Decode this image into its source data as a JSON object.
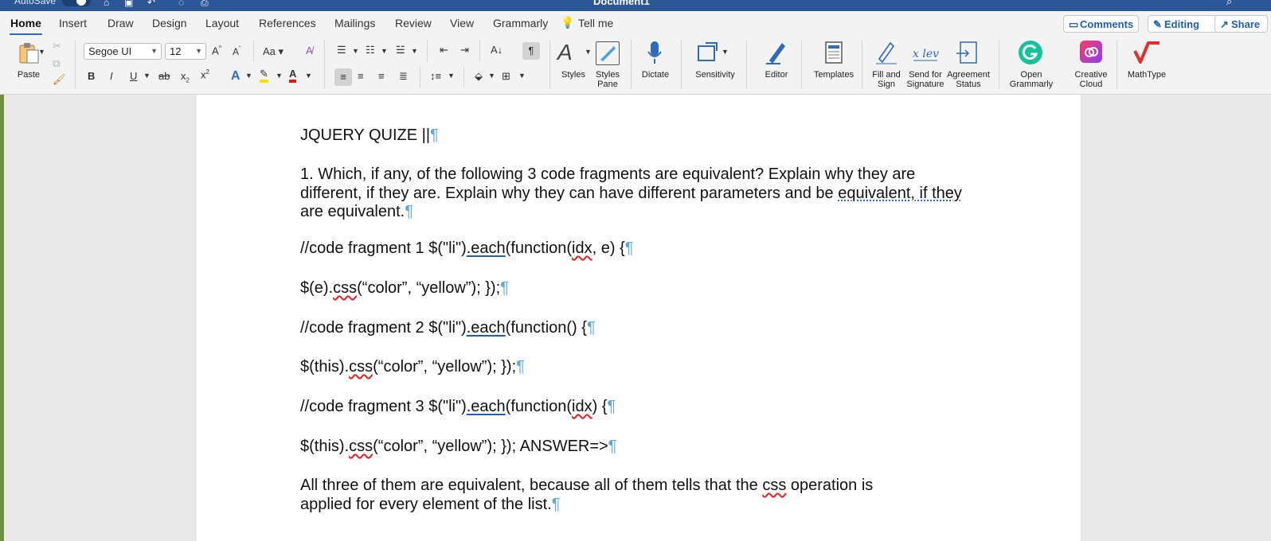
{
  "titlebar": {
    "autosave": "AutoSave",
    "document_title": "Document1"
  },
  "tabs": [
    "Home",
    "Insert",
    "Draw",
    "Design",
    "Layout",
    "References",
    "Mailings",
    "Review",
    "View",
    "Grammarly"
  ],
  "tell_me": "Tell me",
  "comments_label": "Comments",
  "editing_label": "Editing",
  "share_label": "Share",
  "ribbon": {
    "paste_label": "Paste",
    "font_name": "Segoe UI",
    "font_size": "12",
    "styles": "Styles",
    "styles_pane_1": "Styles",
    "styles_pane_2": "Pane",
    "dictate": "Dictate",
    "sensitivity": "Sensitivity",
    "editor": "Editor",
    "templates": "Templates",
    "fill_sign_1": "Fill and",
    "fill_sign_2": "Sign",
    "send_sig_1": "Send for",
    "send_sig_2": "Signature",
    "agreement_1": "Agreement",
    "agreement_2": "Status",
    "grammarly_1": "Open",
    "grammarly_2": "Grammarly",
    "cc_1": "Creative",
    "cc_2": "Cloud",
    "mathtype": "MathType"
  },
  "doc": {
    "title": "JQUERY QUIZE ||",
    "q1_line1": "1. Which, if any, of the following 3 code fragments are equivalent? Explain why they are",
    "q1_line2a": "different, if they are. Explain why they can have different parameters and be ",
    "q1_line2b": "equivalent, if they",
    "q1_line3": "are equivalent.",
    "frag1a": "//code fragment 1 $(\"li\")",
    "frag1b": ".each",
    "frag1c": "(function(",
    "frag1d": "idx",
    "frag1e": ", e) {",
    "css1a": "$(e).",
    "css1b": "css",
    "css1c": "(“color”, “yellow”); });",
    "frag2a": "//code fragment 2 $(\"li\")",
    "frag2b": ".each",
    "frag2c": "(function() {",
    "css2a": "$(this).",
    "css2b": "css",
    "css2c": "(“color”, “yellow”); });",
    "frag3a": "//code fragment 3 $(\"li\")",
    "frag3b": ".each",
    "frag3c": "(function(",
    "frag3d": "idx",
    "frag3e": ") {",
    "css3a": "$(this).",
    "css3b": "css",
    "css3c": "(“color”, “yellow”); }); ANSWER=>",
    "ans_line1a": "All three of them are equivalent, because all of them tells that the ",
    "ans_line1b": "css",
    "ans_line1c": " operation is",
    "ans_line2": "applied for every element of the list.",
    "pilcrow": "¶"
  }
}
